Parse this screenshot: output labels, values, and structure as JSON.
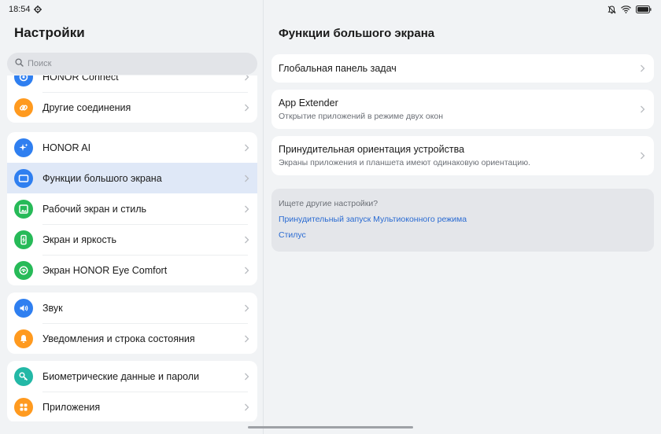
{
  "status_bar": {
    "time": "18:54",
    "icons": [
      "gear-icon",
      "mute-icon",
      "wifi-icon",
      "battery-icon"
    ]
  },
  "left": {
    "title": "Настройки",
    "search_placeholder": "Поиск",
    "groups": [
      {
        "items": [
          {
            "label": "HONOR Connect",
            "icon": "connect-icon",
            "color": "#2f7ff0"
          },
          {
            "label": "Другие соединения",
            "icon": "link-icon",
            "color": "#ff9a1f"
          }
        ]
      },
      {
        "items": [
          {
            "label": "HONOR AI",
            "icon": "ai-sparkle-icon",
            "color": "#2f7ff0"
          },
          {
            "label": "Функции большого экрана",
            "icon": "large-screen-icon",
            "color": "#2f7ff0",
            "active": true
          },
          {
            "label": "Рабочий экран и стиль",
            "icon": "image-icon",
            "color": "#27ba58"
          },
          {
            "label": "Экран и яркость",
            "icon": "phone-brightness-icon",
            "color": "#27ba58"
          },
          {
            "label": "Экран HONOR Eye Comfort",
            "icon": "eye-comfort-icon",
            "color": "#27ba58"
          }
        ]
      },
      {
        "items": [
          {
            "label": "Звук",
            "icon": "speaker-icon",
            "color": "#2f7ff0"
          },
          {
            "label": "Уведомления и строка состояния",
            "icon": "bell-icon",
            "color": "#ff9a1f"
          }
        ]
      },
      {
        "items": [
          {
            "label": "Биометрические данные и пароли",
            "icon": "key-icon",
            "color": "#23b8a6"
          },
          {
            "label": "Приложения",
            "icon": "apps-grid-icon",
            "color": "#ff9a1f"
          }
        ]
      }
    ]
  },
  "right": {
    "title": "Функции большого экрана",
    "items": [
      {
        "title": "Глобальная панель задач",
        "subtitle": ""
      },
      {
        "title": "App Extender",
        "subtitle": "Открытие приложений в режиме двух окон"
      },
      {
        "title": "Принудительная ориентация устройства",
        "subtitle": "Экраны приложения и планшета имеют одинаковую ориентацию."
      }
    ],
    "other": {
      "question": "Ищете другие настройки?",
      "links": [
        "Принудительный запуск Мультиоконного режима",
        "Стилус"
      ]
    }
  },
  "colors": {
    "accent": "#2a6bd2",
    "active_row": "#dfe8f7"
  }
}
